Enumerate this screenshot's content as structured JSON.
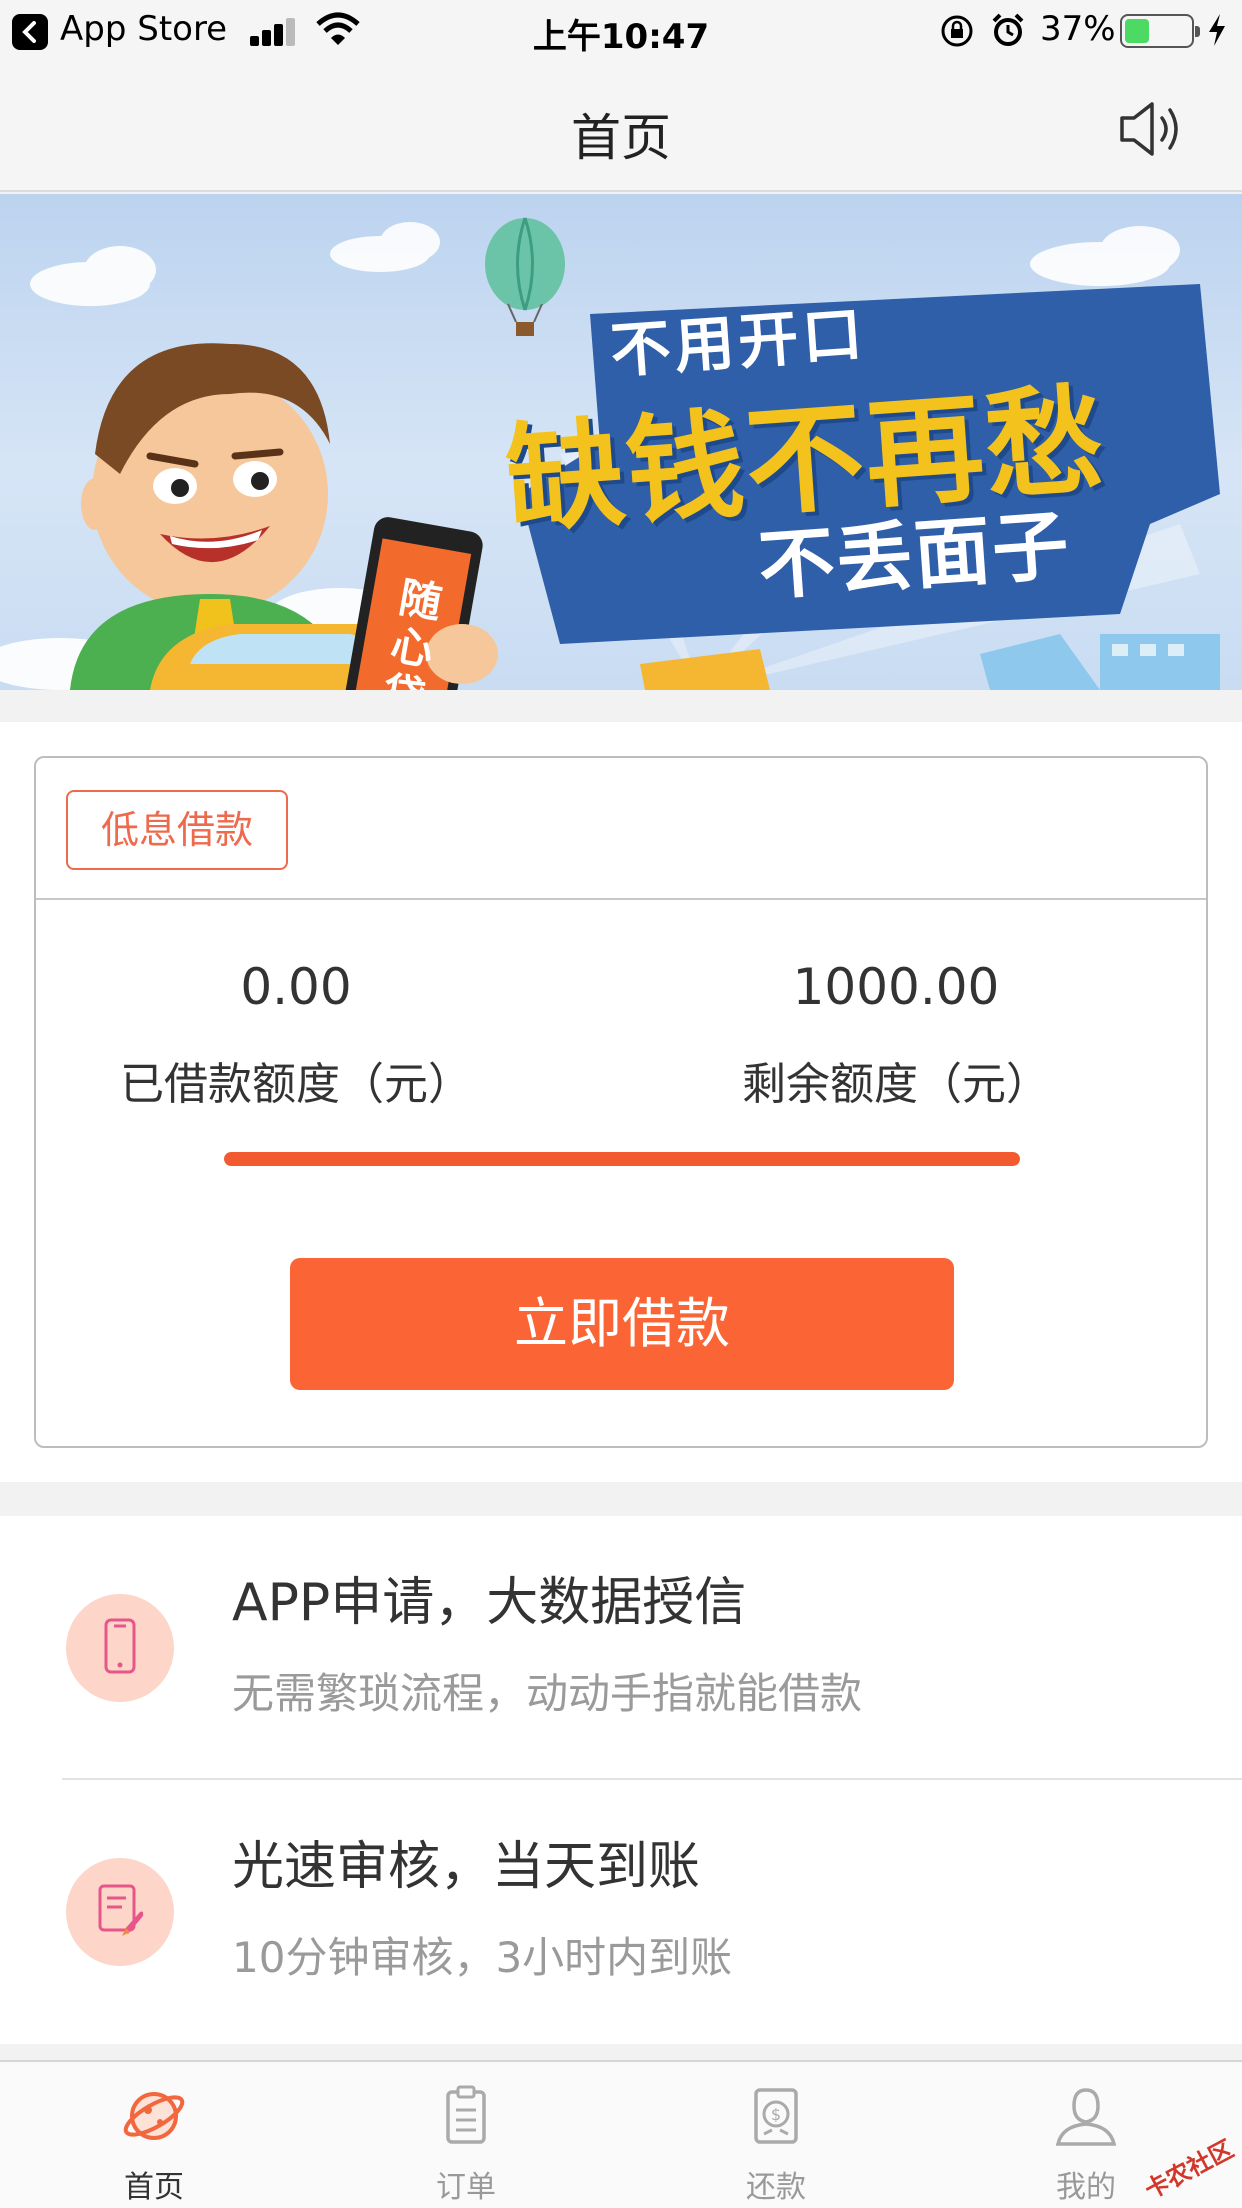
{
  "status_bar": {
    "back_app": "App Store",
    "time": "上午10:47",
    "battery_pct": "37%",
    "battery_level": 0.37,
    "icons": [
      "signal-icon",
      "wifi-icon",
      "orientation-lock-icon",
      "alarm-icon",
      "battery-icon",
      "charging-icon"
    ]
  },
  "nav": {
    "title": "首页",
    "right_icon": "speaker-icon"
  },
  "banner": {
    "line1": "不用开口",
    "line2": "缺钱不再愁",
    "line3": "不丢面子",
    "phone_brand": "随心贷"
  },
  "loan_card": {
    "tag": "低息借款",
    "borrowed_value": "0.00",
    "borrowed_label": "已借款额度（元）",
    "remaining_value": "1000.00",
    "remaining_label": "剩余额度（元）",
    "remaining_fraction": 1.0,
    "button": "立即借款"
  },
  "features": [
    {
      "icon": "phone-icon",
      "title": "APP申请，大数据授信",
      "subtitle": "无需繁琐流程，动动手指就能借款"
    },
    {
      "icon": "document-rocket-icon",
      "title": "光速审核，当天到账",
      "subtitle": "10分钟审核，3小时内到账"
    }
  ],
  "tabs": [
    {
      "icon": "planet-icon",
      "label": "首页",
      "active": true
    },
    {
      "icon": "clipboard-icon",
      "label": "订单",
      "active": false
    },
    {
      "icon": "dollar-cycle-icon",
      "label": "还款",
      "active": false
    },
    {
      "icon": "user-icon",
      "label": "我的",
      "active": false
    }
  ],
  "watermark": "卡农社区",
  "colors": {
    "accent": "#fb6434",
    "tag_border": "#ee6a4d",
    "feature_icon_bg": "#fdd5c9",
    "battery_green": "#4cd964"
  }
}
